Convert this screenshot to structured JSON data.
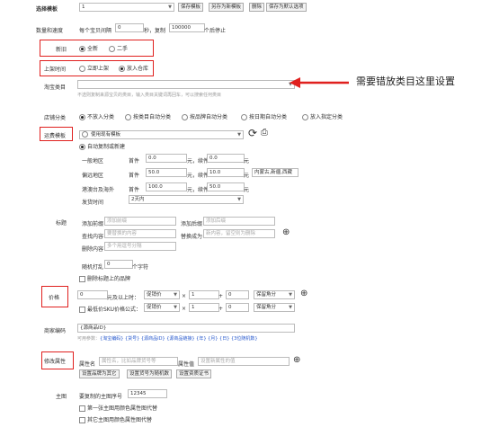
{
  "top": {
    "label": "选择模板",
    "template_value": "1",
    "buttons": [
      "保存模板",
      "另存为新模板",
      "删除",
      "保存为默认选项"
    ]
  },
  "quantity": {
    "label": "数量和速度",
    "prefix": "每个宝贝间隔",
    "interval": "0",
    "sec_label": "秒，复制",
    "count": "100000",
    "suffix": "个后停止"
  },
  "condition": {
    "label": "新旧",
    "options": [
      "全新",
      "二手"
    ],
    "selected": 0
  },
  "listing_time": {
    "label": "上架时间",
    "options": [
      "立即上架",
      "放入仓库"
    ],
    "selected": 1
  },
  "category": {
    "label": "淘宝类目",
    "hint": "不选则复制来源宝贝的类目，输入类目关键词再回车，可以搜索任何类目",
    "annotation": "需要错放类目这里设置"
  },
  "shop_category": {
    "label": "店铺分类",
    "options": [
      "不放入分类",
      "按类目自动分类",
      "按品牌自动分类",
      "按日期自动分类",
      "放入指定分类"
    ],
    "selected": 0
  },
  "shipping": {
    "label": "运费模板",
    "template_select": "使用现有模板",
    "auto_option": "自动复制或新建",
    "regions": [
      {
        "name": "一般地区",
        "first_label": "首件",
        "first": "0.0",
        "extra_label": "元，续件",
        "extra": "0.0",
        "unit": "元",
        "note": ""
      },
      {
        "name": "偏远地区",
        "first_label": "首件",
        "first": "50.0",
        "extra_label": "元，续件",
        "extra": "10.0",
        "unit": "元",
        "note": "内蒙古,新疆,西藏"
      },
      {
        "name": "港澳台及海外",
        "first_label": "首件",
        "first": "100.0",
        "extra_label": "元，续件",
        "extra": "50.0",
        "unit": "元",
        "note": ""
      }
    ],
    "ship_time_label": "发货时间",
    "ship_time": "2天内"
  },
  "title": {
    "label": "标题",
    "add_prefix_label": "添加前缀",
    "add_prefix_ph": "添加前缀",
    "add_suffix_label": "添加后缀",
    "add_suffix_ph": "添加后缀",
    "find_label": "查找内容",
    "find_ph": "要替换的内容",
    "replace_label": "替换成为",
    "replace_ph": "新内容，留空则为删除",
    "delete_label": "删除内容",
    "delete_ph": "多个用逗号分隔",
    "shuffle_label": "随机打乱",
    "shuffle_value": "0",
    "shuffle_unit": "个字符",
    "remove_brand": "删除标题上的品牌"
  },
  "price": {
    "label": "价格",
    "row1_value": "0",
    "row1_text": "元及以上时：",
    "row1_select": "促销价",
    "mult": "×",
    "mult_value": "1",
    "plus": "+",
    "plus_value": "0",
    "round": "保留角分",
    "row2_text": "最低价SKU价格公式：",
    "row2_select": "促销价",
    "row2_mult_value": "1",
    "row2_plus_value": "0",
    "row2_round": "保留角分"
  },
  "merchant_code": {
    "label": "商家编码",
    "value": "{源商品ID}",
    "vars_prefix": "可用参数：",
    "vars": "{淘宝编码} {货号} {源商品ID} {源商品链接} {年} {月} {日} {3位随机数}"
  },
  "attributes": {
    "label": "修改属性",
    "name_label": "属性名",
    "name_ph": "属性名，比如品牌货号等",
    "value_label": "属性值",
    "value_ph": "设置新属性的值",
    "buttons": [
      "设置品牌为其它",
      "设置货号为随机数",
      "设置资质证书"
    ]
  },
  "main_image": {
    "label": "主图",
    "copy_label": "要复制的主图序号",
    "copy_value": "12345",
    "opt1": "第一张主图用颜色属性图代替",
    "opt2": "其它主图用颜色属性图代替"
  },
  "colors": {
    "accent": "#e0201e",
    "link": "#2255cc"
  }
}
